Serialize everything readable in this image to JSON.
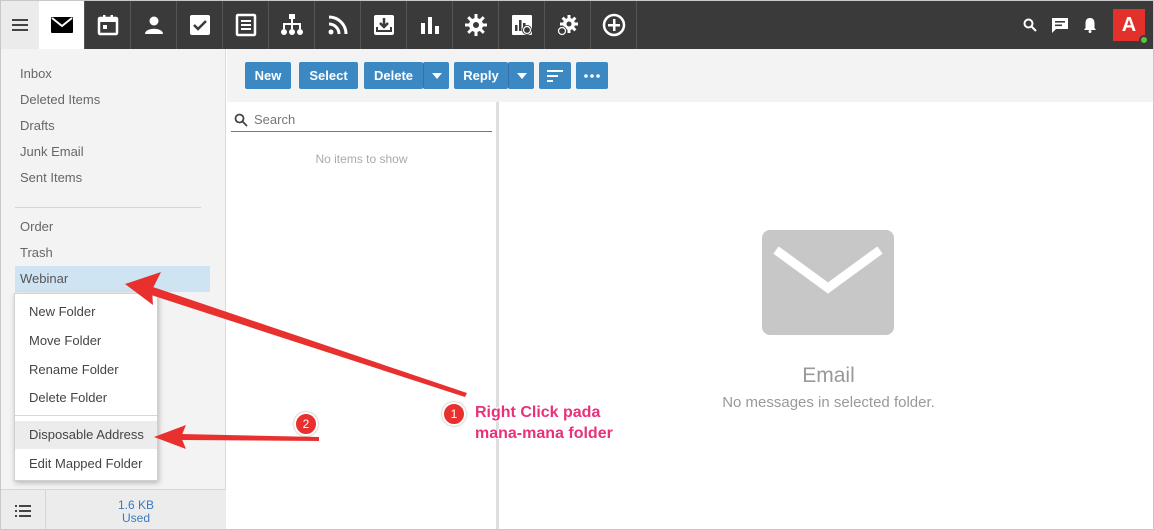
{
  "apps": [
    {
      "name": "mail-icon",
      "active": true
    },
    {
      "name": "calendar-icon"
    },
    {
      "name": "contacts-icon"
    },
    {
      "name": "tasks-icon"
    },
    {
      "name": "notes-icon"
    },
    {
      "name": "org-chart-icon"
    },
    {
      "name": "rss-icon"
    },
    {
      "name": "archive-icon"
    },
    {
      "name": "reports-icon"
    },
    {
      "name": "settings-icon"
    },
    {
      "name": "domain-reports-icon"
    },
    {
      "name": "domain-settings-icon"
    },
    {
      "name": "add-icon"
    }
  ],
  "user": {
    "initial": "A",
    "avatar_color": "#e2312a"
  },
  "folders": {
    "system": [
      "Inbox",
      "Deleted Items",
      "Drafts",
      "Junk Email",
      "Sent Items"
    ],
    "custom": [
      "Order",
      "Trash",
      "Webinar"
    ],
    "selected": "Webinar"
  },
  "context_menu": {
    "items": [
      "New Folder",
      "Move Folder",
      "Rename Folder",
      "Delete Folder",
      "Disposable Address",
      "Edit Mapped Folder"
    ],
    "highlighted": "Disposable Address"
  },
  "storage": {
    "size": "1.6 KB",
    "label": "Used"
  },
  "toolbar": {
    "new": "New",
    "select": "Select",
    "delete": "Delete",
    "reply": "Reply",
    "button_color": "#3b88c3"
  },
  "list": {
    "search_placeholder": "Search",
    "empty_text": "No items to show"
  },
  "reading_pane": {
    "title": "Email",
    "subtitle": "No messages in selected folder."
  },
  "annotations": {
    "step1_number": "1",
    "step1_line1": "Right Click pada",
    "step1_line2": "mana-mana folder",
    "step2_number": "2",
    "arrow_color": "#e8312f",
    "text_color": "#e8317a"
  }
}
